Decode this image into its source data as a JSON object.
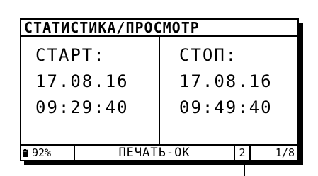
{
  "title": "СТАТИСТИКА/ПРОСМОТР",
  "start": {
    "label": "СТАРТ:",
    "date": "17.08.16",
    "time": "09:29:40"
  },
  "stop": {
    "label": "СТОП:",
    "date": "17.08.16",
    "time": "09:49:40"
  },
  "status": {
    "battery_icon": "battery-icon",
    "battery_percent": "92%",
    "print_status": "ПЕЧАТЬ-ОК",
    "channel": "2",
    "page": "1/8"
  }
}
